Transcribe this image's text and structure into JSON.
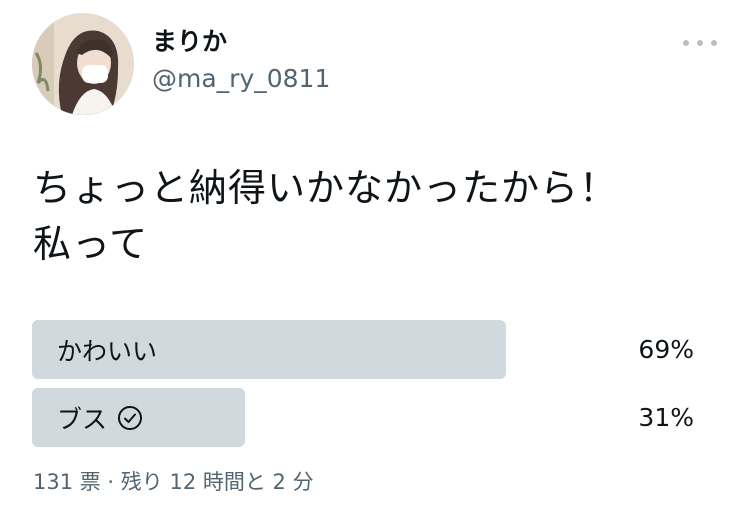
{
  "author": {
    "display_name": "まりか",
    "handle": "@ma_ry_0811"
  },
  "tweet": {
    "lines": [
      "ちょっと納得いかなかったから！",
      "私って"
    ]
  },
  "poll": {
    "options": [
      {
        "label": "かわいい",
        "percent": 69,
        "percent_text": "69%",
        "selected": false
      },
      {
        "label": "ブス",
        "percent": 31,
        "percent_text": "31%",
        "selected": true
      }
    ],
    "meta": "131 票 · 残り 12 時間と 2 分"
  },
  "icons": {
    "more": "more-horizontal-icon",
    "selected": "check-circle-icon"
  },
  "colors": {
    "text": "#0f1419",
    "secondary": "#536471",
    "poll_bar": "#cfd9de"
  }
}
